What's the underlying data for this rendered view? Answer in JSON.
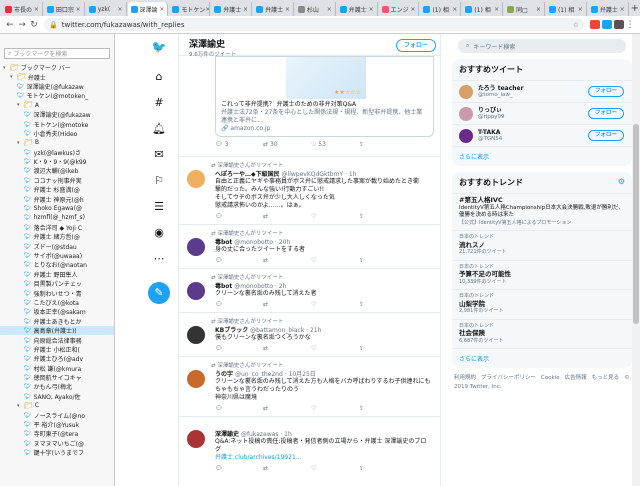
{
  "tabs": [
    {
      "title": "市長の",
      "color": "#d33"
    },
    {
      "title": "田口宗",
      "color": "#1da1f2"
    },
    {
      "title": "yzk(",
      "color": "#1da1f2"
    },
    {
      "title": "深澤論",
      "color": "#1da1f2",
      "active": true
    },
    {
      "title": "モトケン",
      "color": "#1da1f2"
    },
    {
      "title": "弁護士",
      "color": "#1da1f2"
    },
    {
      "title": "弁護士",
      "color": "#1da1f2"
    },
    {
      "title": "杉山",
      "color": "#888"
    },
    {
      "title": "弁護士",
      "color": "#1da1f2"
    },
    {
      "title": "エンジ",
      "color": "#e57"
    },
    {
      "title": "(1) 相",
      "color": "#1da1f2"
    },
    {
      "title": "(1) 相",
      "color": "#1da1f2"
    },
    {
      "title": "同□",
      "color": "#8a4"
    },
    {
      "title": "(1) 相",
      "color": "#1da1f2"
    },
    {
      "title": "弁護士",
      "color": "#1da1f2"
    }
  ],
  "address": {
    "url": "twitter.com/fukazawas/with_replies"
  },
  "bookmarks": {
    "search_placeholder": "ブックマークを検索",
    "items": [
      {
        "t": "ブックマーク バー",
        "type": "folder",
        "lv": 0
      },
      {
        "t": "弁護士",
        "type": "folder",
        "lv": 1
      },
      {
        "t": "深澤諭史(@fukazaw",
        "type": "tw",
        "lv": 2
      },
      {
        "t": "モトケン(@motoken_",
        "type": "tw",
        "lv": 2
      },
      {
        "t": "A",
        "type": "folder",
        "lv": 2
      },
      {
        "t": "深澤諭史(@fukazaw",
        "type": "tw",
        "lv": 3
      },
      {
        "t": "モトケン(@motoke",
        "type": "tw",
        "lv": 3
      },
      {
        "t": "小倉秀夫(Hideo",
        "type": "tw",
        "lv": 3
      },
      {
        "t": "B",
        "type": "folder",
        "lv": 2
      },
      {
        "t": "yzk(@lawkus)さ",
        "type": "tw",
        "lv": 3
      },
      {
        "t": "K・9・9・9(@k99",
        "type": "tw",
        "lv": 3
      },
      {
        "t": "渡辺大輔(@ikeb",
        "type": "tw",
        "lv": 3
      },
      {
        "t": "ココナッ刑事弁実",
        "type": "tw",
        "lv": 3
      },
      {
        "t": "弁護士 杉盛満(@",
        "type": "tw",
        "lv": 3
      },
      {
        "t": "弁護士 神原元(@h",
        "type": "tw",
        "lv": 3
      },
      {
        "t": "Shoko Egawa(@",
        "type": "tw",
        "lv": 3
      },
      {
        "t": "hzmfl(@_hzmf_s)",
        "type": "tw",
        "lv": 3
      },
      {
        "t": "落合洋司 ◆ Yoji C",
        "type": "tw",
        "lv": 3
      },
      {
        "t": "弁護士 緒方哲(@",
        "type": "tw",
        "lv": 3
      },
      {
        "t": "ズドー(@stdau",
        "type": "tw",
        "lv": 3
      },
      {
        "t": "サイボ(@uwaaa)",
        "type": "tw",
        "lv": 3
      },
      {
        "t": "とりなお(@naotan",
        "type": "tw",
        "lv": 3
      },
      {
        "t": "弁護士 野田隼人",
        "type": "tw",
        "lv": 3
      },
      {
        "t": "目黒製パンチェッ",
        "type": "tw",
        "lv": 3
      },
      {
        "t": "強制わいせつ・青",
        "type": "tw",
        "lv": 3
      },
      {
        "t": "こたびえ(@kota",
        "type": "tw",
        "lv": 3
      },
      {
        "t": "坂本正幸(@sakam",
        "type": "tw",
        "lv": 3
      },
      {
        "t": "弁護士あきもとか",
        "type": "tw",
        "lv": 3
      },
      {
        "t": "高島章(弁護士)(",
        "type": "tw",
        "lv": 3,
        "sel": true
      },
      {
        "t": "向原総合法律事務",
        "type": "tw",
        "lv": 3
      },
      {
        "t": "弁護士 小松正和(",
        "type": "tw",
        "lv": 3
      },
      {
        "t": "弁護士ひろ(@adv",
        "type": "tw",
        "lv": 3
      },
      {
        "t": "村松 謙(@kmura",
        "type": "tw",
        "lv": 3
      },
      {
        "t": "徳岡航サイコキャ",
        "type": "tw",
        "lv": 3
      },
      {
        "t": "かもん弓(梅北",
        "type": "tw",
        "lv": 3
      },
      {
        "t": "SANO, Ayako/佐",
        "type": "tw",
        "lv": 3
      },
      {
        "t": "C",
        "type": "folder",
        "lv": 2
      },
      {
        "t": "ノースライム(@no",
        "type": "tw",
        "lv": 3
      },
      {
        "t": "平 裕介(@Yusuk",
        "type": "tw",
        "lv": 3
      },
      {
        "t": "寺町東子(@tera",
        "type": "tw",
        "lv": 3
      },
      {
        "t": "ヌマヌマいちご(@",
        "type": "tw",
        "lv": 3
      },
      {
        "t": "鍵十字(いうまでフ",
        "type": "tw",
        "lv": 3
      }
    ]
  },
  "profile": {
    "name": "深澤諭史",
    "tweet_count": "9.6万件のツイート",
    "follow_label": "フォロー"
  },
  "card": {
    "title": "これって非弁提携？ 弁護士のための非弁対策Q&A",
    "desc": "弁護士法72条・27条を中心とした関係法規・規程、新型非弁提携、他士業連携と非弁に…",
    "domain": "amazon.co.jp",
    "actions": [
      "3",
      "30",
      "53",
      ""
    ]
  },
  "tweets": [
    {
      "rt": "深澤諭史さんがリツイート",
      "name": "へぽろーや…◆下級国民",
      "handle": "@llwpevKQdGktbmY · 1h",
      "avatar": "#f0b060",
      "lines": [
        "自由と正義にヤギや事務員がボス弁に懲戒請求した事案が載り始めたとき衝",
        "撃的だった。みんな強い!行動力すごい!!",
        "そしてウチのボス弁が少し大人しくなった気",
        "懲戒請求怖いのかよ……。はぁ。"
      ]
    },
    {
      "rt": "深澤諭史さんがリツイート",
      "name": "毒bot",
      "handle": "@monobotto · 20h",
      "avatar": "#5b3b8c",
      "lines": [
        "身の丈に合ったツイートをする者"
      ]
    },
    {
      "rt": "深澤諭史さんがリツイート",
      "name": "毒bot",
      "handle": "@monobotto · 2h",
      "avatar": "#5b3b8c",
      "lines": [
        "クリーンな裏名垢のみ残して消えた者"
      ]
    },
    {
      "rt": "深澤諭史さんがリツイート",
      "name": "KBブラック",
      "handle": "@battamon_black · 21h",
      "avatar": "#333",
      "lines": [
        "僕もクリーンな裏名垢つくろうかな"
      ]
    },
    {
      "rt": "深澤諭史さんがリツイート",
      "name": "うの字",
      "handle": "@un_co_the2nd · 10月25日",
      "avatar": "#c86a2a",
      "lines": [
        "クリーンな裏名垢のみ残して消えた方も人格をバカ呼ばわりするわ子供連れにも",
        "ちゃもちゃ言うわだったりのう",
        "神奈川県は魔境"
      ]
    },
    {
      "rt": "",
      "name": "深澤諭史",
      "handle": "@fukazawas · 1h",
      "avatar": "#a33",
      "lines": [
        "Q&A:ネット投稿の責任:投稿者・発信者側の立場から・弁護士 深澤諭史のブロ",
        "グ"
      ],
      "link": "弁護士.club/archives/19921..."
    }
  ],
  "right": {
    "search_placeholder": "キーワード検索",
    "who_title": "おすすめツイート",
    "users": [
      {
        "name": "たろう teacher",
        "handle": "@tomo_law_",
        "avatar": "#d9a066"
      },
      {
        "name": "りっぴぃ",
        "handle": "@rippy09",
        "avatar": "#c9a"
      },
      {
        "name": "T-TAKA",
        "handle": "@TGN54",
        "avatar": "#6a2a8c"
      }
    ],
    "follow_label": "フォロー",
    "more_label": "さらに表示",
    "trends_title": "おすすめトレンド",
    "trends": [
      {
        "ctx": "",
        "name": "#第五人格IVC",
        "desc": "IdentityV第五人格Championship日本大会決勝戦,敗退が勝利だ,優勝を決める時は来た",
        "count": "【公式】IdentityV第五人格によるプロモーション"
      },
      {
        "ctx": "日本のトレンド",
        "name": "流れスノ",
        "desc": "",
        "count": "21,721件のツイート"
      },
      {
        "ctx": "日本のトレンド",
        "name": "予算不足の可能性",
        "desc": "",
        "count": "10,339件のツイート"
      },
      {
        "ctx": "日本のトレンド",
        "name": "山梨学院",
        "desc": "",
        "count": "2,981件のツイート"
      },
      {
        "ctx": "日本のトレンド",
        "name": "社会保険",
        "desc": "",
        "count": "6,687件のツイート"
      }
    ],
    "trends_more": "さらに表示",
    "footer": [
      "利用規約",
      "プライバシーポリシー",
      "Cookie",
      "広告情報",
      "もっと見る",
      "© 2019 Twitter, Inc."
    ]
  }
}
